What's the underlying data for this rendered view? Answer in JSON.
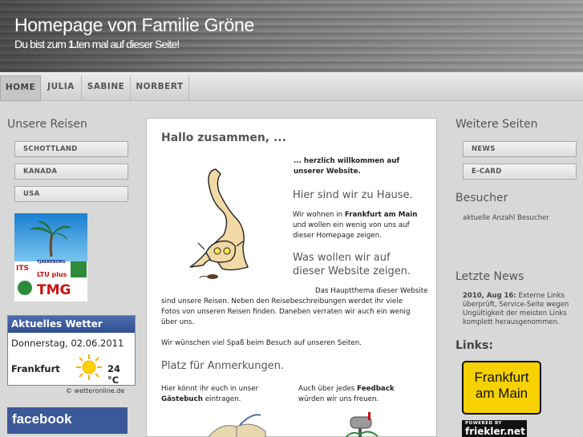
{
  "header": {
    "title": "Homepage von Familie Gröne",
    "sub_prefix": "Du bist zum ",
    "sub_count": "1.",
    "sub_suffix": "ten mal auf dieser Seite!"
  },
  "nav": {
    "items": [
      "HOME",
      "JULIA",
      "SABINE",
      "NORBERT"
    ],
    "active": "HOME"
  },
  "left": {
    "title": "Unsere Reisen",
    "buttons": [
      "SCHOTTLAND",
      "KANADA",
      "USA"
    ],
    "promo_logos": [
      "ITS",
      "TJAEREBORG",
      "LTU plus",
      "TMG"
    ],
    "weather": {
      "title": "Aktuelles Wetter",
      "date": "Donnerstag, 02.06.2011",
      "city": "Frankfurt",
      "temp": "24 °C",
      "source": "©  wetteronline.de"
    },
    "facebook": "facebook"
  },
  "content": {
    "title": "Hallo zusammen, ...",
    "welcome_1": "... herzlich willkommen auf",
    "welcome_2": "unserer Website.",
    "home_heading": "Hier sind wir zu Hause.",
    "home_text_1": "Wir wohnen in ",
    "home_text_city": "Frankfurt am Main",
    "home_text_2": "und wollen ein wenig von uns auf",
    "home_text_3": "dieser Homepage zeigen.",
    "show_heading_1": "Was wollen wir auf",
    "show_heading_2": "dieser Website zeigen.",
    "show_text_1": "Das Hauptthema dieser Website",
    "show_text_2": "sind unsere Reisen. Neben den Reisebeschreibungen werdet ihr viele",
    "show_text_3": "Fotos von unseren Reisen finden. Daneben verraten wir auch ein wenig",
    "show_text_4": "über uns.",
    "wish": "Wir wünschen viel Spaß beim Besuch auf unseren Seiten.",
    "notes_heading": "Platz für Anmerkungen.",
    "notes_left_1": "Hier könnt ihr euch in unser",
    "notes_left_2": "Gästebuch",
    "notes_left_3": " eintragen.",
    "notes_right_1": "Auch über jedes ",
    "notes_right_2": "Feedback",
    "notes_right_3": "würden wir uns freuen."
  },
  "right": {
    "title": "Weitere Seiten",
    "buttons": [
      "NEWS",
      "E-CARD"
    ],
    "visitors_title": "Besucher",
    "visitors_text": "aktuelle Anzahl Besucher",
    "news_title": "Letzte News",
    "news_date": "2010, Aug 16:",
    "news_line_1": " Externe Links",
    "news_line_2": "überprüft, Service-Seite wegen",
    "news_line_3": "Ungültigkeit der meisten Links",
    "news_line_4": "komplett herausgenommen.",
    "links_title": "Links:",
    "ffm_1": "Frankfurt",
    "ffm_2": "am Main",
    "friekler_tag": "POWERED BY",
    "friekler_name": "friekler.net"
  },
  "colors": {
    "weather_header": "#2f4f8f",
    "facebook": "#3b5998",
    "ffm_badge": "#f7d100"
  }
}
